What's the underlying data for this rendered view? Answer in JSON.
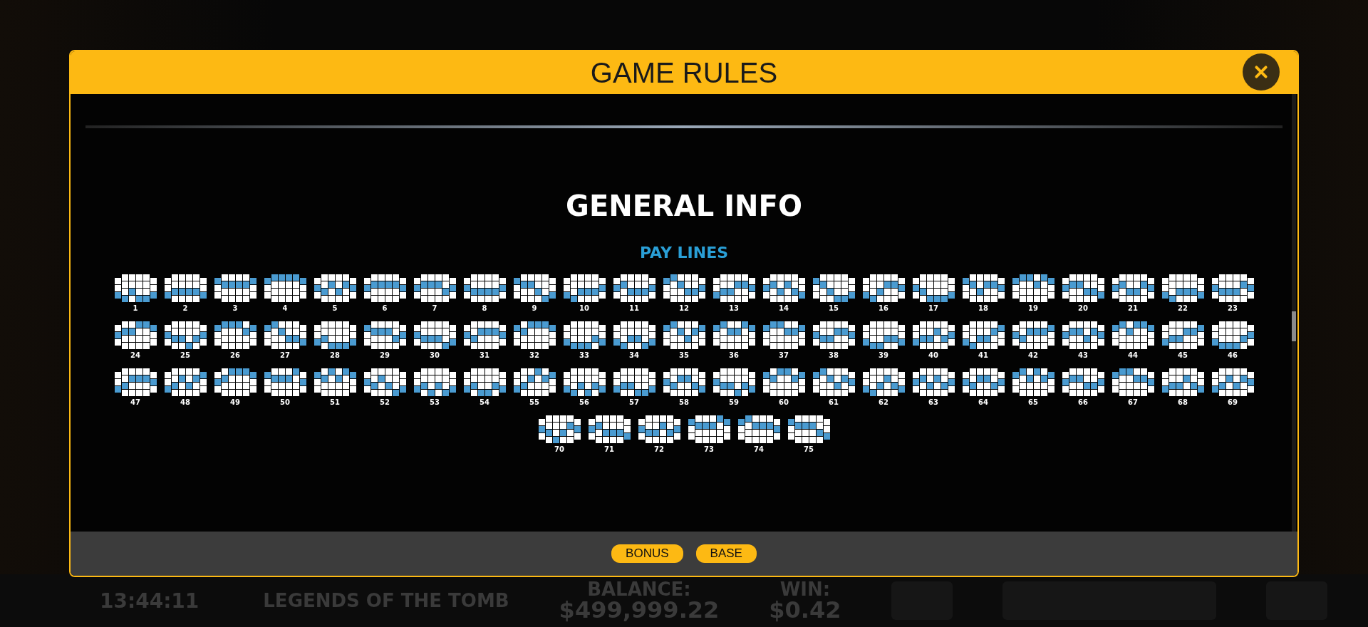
{
  "dialog": {
    "title": "GAME RULES",
    "section_title": "GENERAL INFO",
    "subsection_title": "PAY LINES",
    "paylines": [
      {
        "label": "1"
      },
      {
        "label": "2"
      },
      {
        "label": "3"
      },
      {
        "label": "4"
      },
      {
        "label": "5"
      },
      {
        "label": "6"
      },
      {
        "label": "7"
      },
      {
        "label": "8"
      },
      {
        "label": "9"
      },
      {
        "label": "10"
      },
      {
        "label": "11"
      },
      {
        "label": "12"
      },
      {
        "label": "13"
      },
      {
        "label": "14"
      },
      {
        "label": "15"
      },
      {
        "label": "16"
      },
      {
        "label": "17"
      },
      {
        "label": "18"
      },
      {
        "label": "19"
      },
      {
        "label": "20"
      },
      {
        "label": "21"
      },
      {
        "label": "22"
      },
      {
        "label": "23"
      },
      {
        "label": "24"
      },
      {
        "label": "25"
      },
      {
        "label": "26"
      },
      {
        "label": "27"
      },
      {
        "label": "28"
      },
      {
        "label": "29"
      },
      {
        "label": "30"
      },
      {
        "label": "31"
      },
      {
        "label": "32"
      },
      {
        "label": "33"
      },
      {
        "label": "34"
      },
      {
        "label": "35"
      },
      {
        "label": "36"
      },
      {
        "label": "37"
      },
      {
        "label": "38"
      },
      {
        "label": "39"
      },
      {
        "label": "40"
      },
      {
        "label": "41"
      },
      {
        "label": "42"
      },
      {
        "label": "43"
      },
      {
        "label": "44"
      },
      {
        "label": "45"
      },
      {
        "label": "46"
      },
      {
        "label": "47"
      },
      {
        "label": "48"
      },
      {
        "label": "49"
      },
      {
        "label": "50"
      },
      {
        "label": "51"
      },
      {
        "label": "52"
      },
      {
        "label": "53"
      },
      {
        "label": "54"
      },
      {
        "label": "55"
      },
      {
        "label": "56"
      },
      {
        "label": "57"
      },
      {
        "label": "58"
      },
      {
        "label": "59"
      },
      {
        "label": "60"
      },
      {
        "label": "61"
      },
      {
        "label": "62"
      },
      {
        "label": "63"
      },
      {
        "label": "64"
      },
      {
        "label": "65"
      },
      {
        "label": "66"
      },
      {
        "label": "67"
      },
      {
        "label": "68"
      },
      {
        "label": "69"
      },
      {
        "label": "70"
      },
      {
        "label": "71"
      },
      {
        "label": "72"
      },
      {
        "label": "73"
      },
      {
        "label": "74"
      },
      {
        "label": "75"
      }
    ],
    "footer_buttons": [
      {
        "label": "BONUS"
      },
      {
        "label": "BASE"
      }
    ]
  },
  "status_bar": {
    "time": "13:44:11",
    "game_title": "LEGENDS OF THE TOMB",
    "balance_label": "BALANCE:",
    "balance": "$499,999.22",
    "win_label": "WIN:",
    "win": "$0.42"
  }
}
